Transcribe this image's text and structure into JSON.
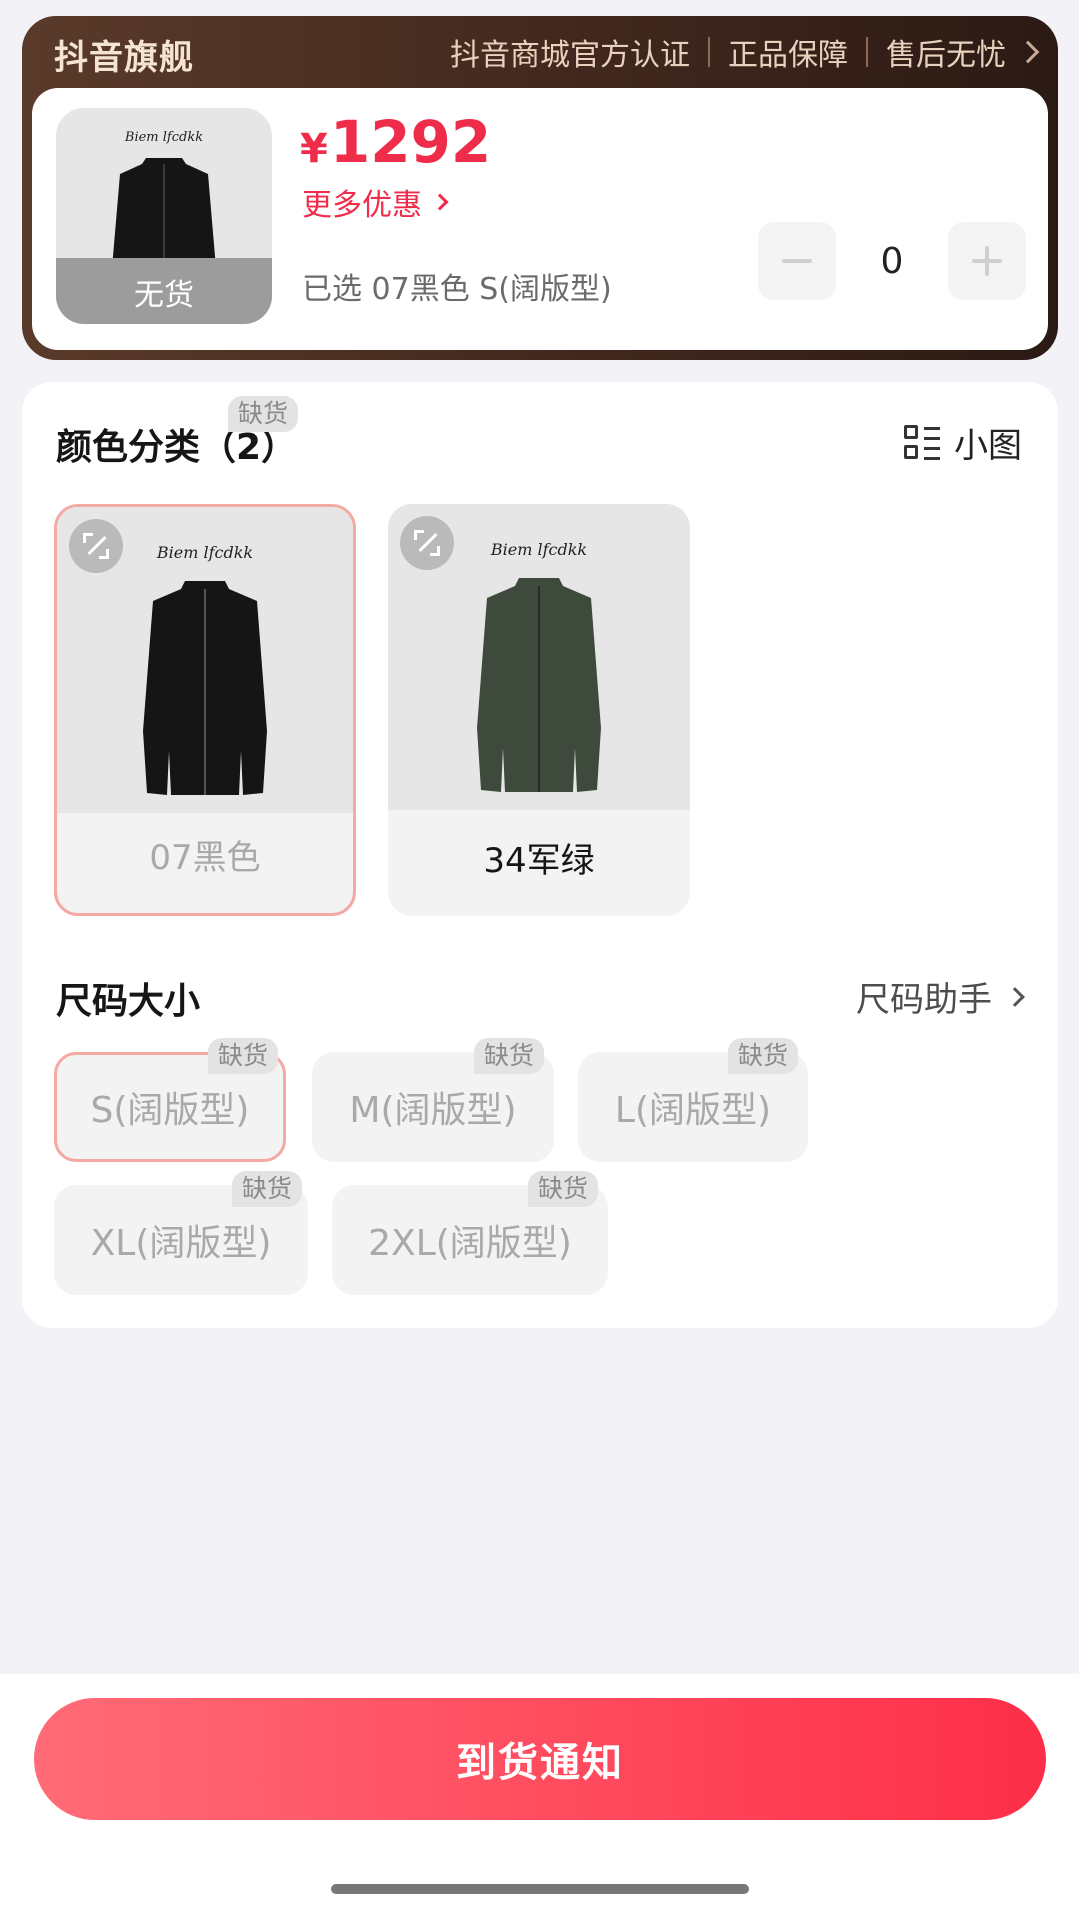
{
  "brand": {
    "title": "抖音旗舰",
    "tags": [
      "抖音商城官方认证",
      "正品保障",
      "售后无忧"
    ]
  },
  "product": {
    "currency": "¥",
    "price": "1292",
    "more_deals": "更多优惠",
    "thumb_overlay": "无货",
    "thumb_logo": "Biem lfcdkk",
    "selected": "已选 07黑色 S(阔版型)",
    "quantity": "0"
  },
  "colors": {
    "title": "颜色分类（2）",
    "view_toggle": "小图",
    "items": [
      {
        "name": "07黑色",
        "logo": "Biem lfcdkk",
        "badge": "缺货",
        "jacket_color": "#151515"
      },
      {
        "name": "34军绿",
        "logo": "Biem lfcdkk",
        "badge": "",
        "jacket_color": "#3e4a3c"
      }
    ]
  },
  "sizes": {
    "title": "尺码大小",
    "helper": "尺码助手",
    "items": [
      {
        "label": "S(阔版型)",
        "badge": "缺货"
      },
      {
        "label": "M(阔版型)",
        "badge": "缺货"
      },
      {
        "label": "L(阔版型)",
        "badge": "缺货"
      },
      {
        "label": "XL(阔版型)",
        "badge": "缺货"
      },
      {
        "label": "2XL(阔版型)",
        "badge": "缺货"
      }
    ]
  },
  "footer": {
    "notify_label": "到货通知"
  }
}
